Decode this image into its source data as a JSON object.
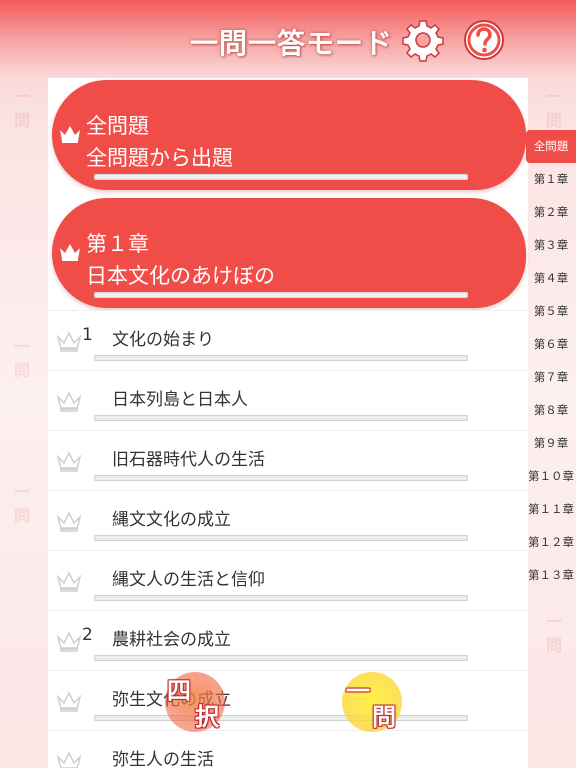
{
  "header": {
    "title": "一問一答モード"
  },
  "icons": {
    "settings": "gear-icon",
    "help": "help-circle-icon",
    "crown": "crown-icon"
  },
  "colors": {
    "accent_red": "#f04d48",
    "header_red": "#f45a5a",
    "mode_one_yellow": "#fbe23a"
  },
  "cards": [
    {
      "title": "全問題",
      "subtitle": "全問題から出題"
    },
    {
      "title": "第１章",
      "subtitle": "日本文化のあけぼの"
    }
  ],
  "rows": [
    {
      "num": "1",
      "label": "文化の始まり"
    },
    {
      "num": "",
      "label": "日本列島と日本人"
    },
    {
      "num": "",
      "label": "旧石器時代人の生活"
    },
    {
      "num": "",
      "label": "縄文文化の成立"
    },
    {
      "num": "",
      "label": "縄文人の生活と信仰"
    },
    {
      "num": "2",
      "label": "農耕社会の成立"
    },
    {
      "num": "",
      "label": "弥生文化の成立"
    },
    {
      "num": "",
      "label": "弥生人の生活"
    }
  ],
  "chapters": [
    "全問題",
    "第１章",
    "第２章",
    "第３章",
    "第４章",
    "第５章",
    "第６章",
    "第７章",
    "第８章",
    "第９章",
    "第１０章",
    "第１１章",
    "第１２章",
    "第１３章"
  ],
  "mode_buttons": {
    "four_choice": {
      "top": "四",
      "bottom": "択"
    },
    "one_answer": {
      "top": "一",
      "bottom": "問"
    }
  }
}
